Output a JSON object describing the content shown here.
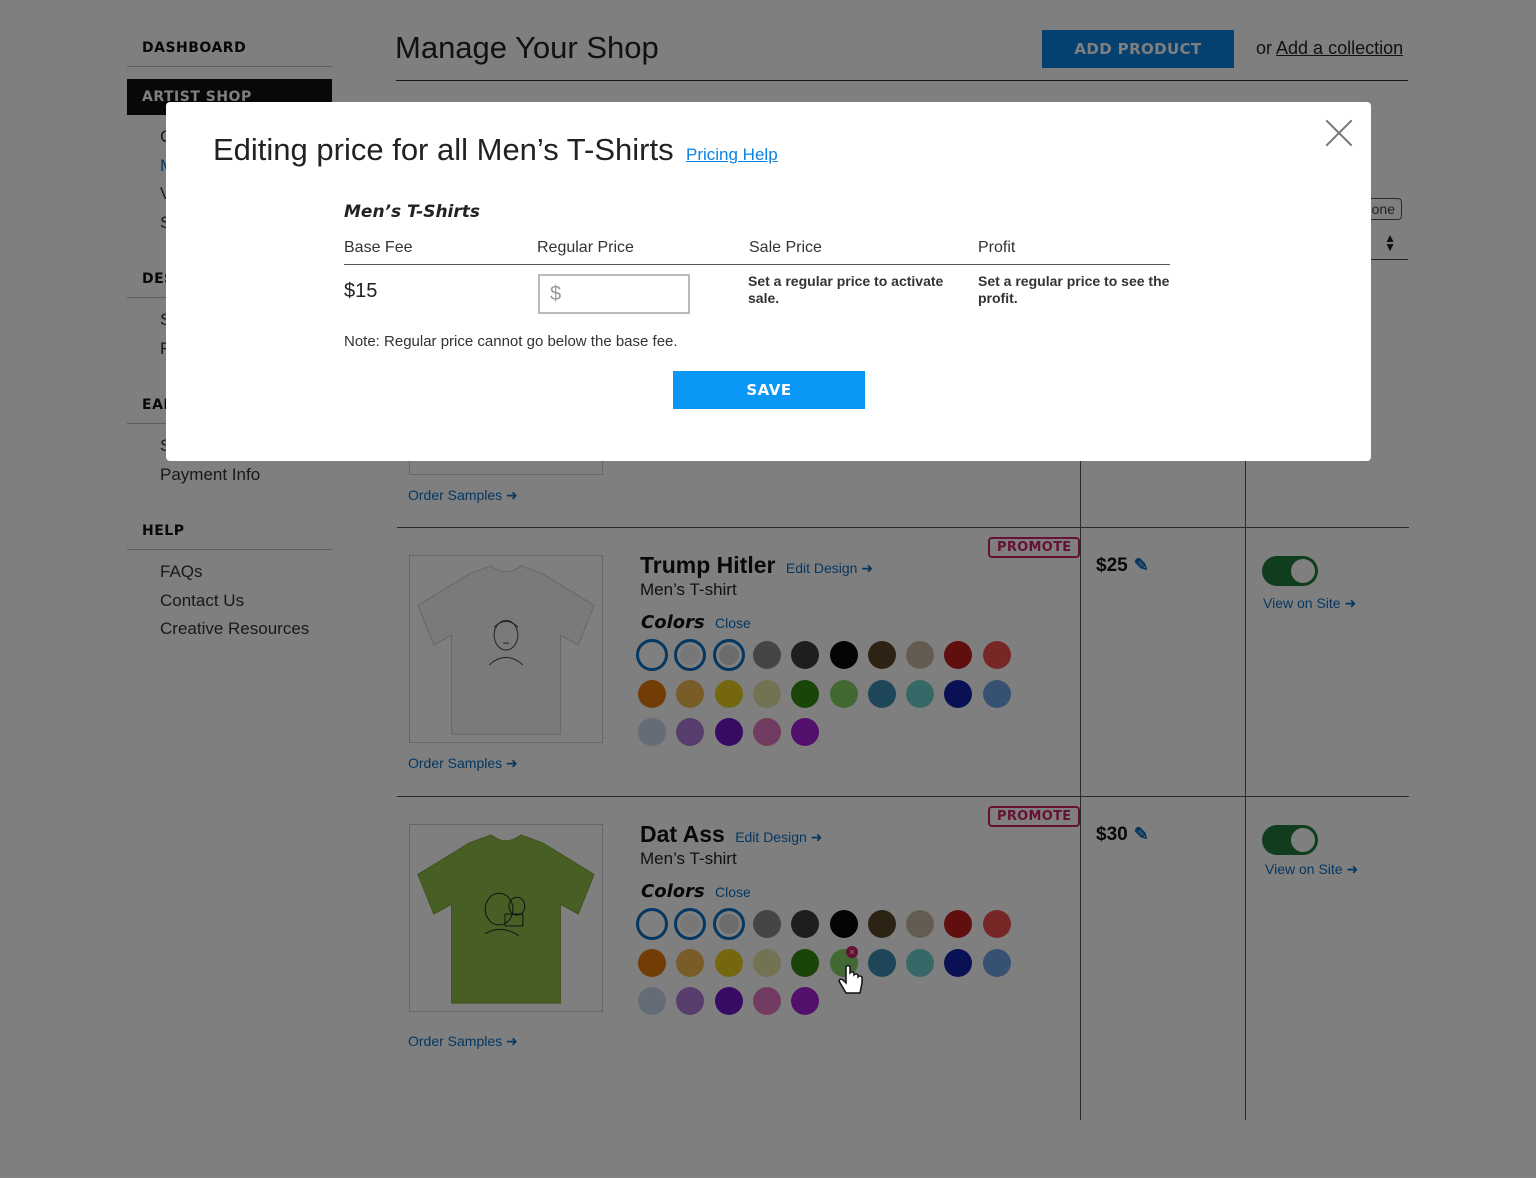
{
  "sidebar": {
    "dashboard": "DASHBOARD",
    "artist_shop": "ARTIST SHOP",
    "artist_shop_items": [
      "C",
      "M",
      "V",
      "S"
    ],
    "design": "DES",
    "design_items": [
      "S",
      "F"
    ],
    "earnings": "EAI",
    "earnings_items": [
      "S",
      "Payment Info"
    ],
    "help": "HELP",
    "help_items": [
      "FAQs",
      "Contact Us",
      "Creative Resources"
    ]
  },
  "header": {
    "title": "Manage Your Shop",
    "add_product": "ADD PRODUCT",
    "or": "or",
    "add_collection": "Add a collection"
  },
  "background": {
    "filter_label": "one",
    "select_arrows": "▲▼"
  },
  "modal": {
    "title": "Editing price for all Men’s T-Shirts",
    "pricing_help": "Pricing Help",
    "section_title": "Men’s T-Shirts",
    "columns": [
      "Base Fee",
      "Regular Price",
      "Sale Price",
      "Profit"
    ],
    "base_fee": "$15",
    "price_placeholder": "$",
    "sale_note": "Set a regular price to activate sale.",
    "profit_note": "Set a regular price to see the profit.",
    "footnote": "Note: Regular price cannot go below the base fee.",
    "save": "SAVE"
  },
  "products": [
    {
      "order_samples": "Order Samples ➜"
    },
    {
      "title": "Trump Hitler",
      "edit_design": "Edit Design ➜",
      "type": "Men’s T-shirt",
      "colors_label": "Colors",
      "colors_close": "Close",
      "promote": "PROMOTE",
      "price": "$25",
      "view_on_site": "View on Site ➜",
      "order_samples": "Order Samples ➜",
      "enabled": true,
      "shirt_color": "#f4f4f4"
    },
    {
      "title": "Dat Ass",
      "edit_design": "Edit Design ➜",
      "type": "Men’s T-shirt",
      "colors_label": "Colors",
      "colors_close": "Close",
      "promote": "PROMOTE",
      "price": "$30",
      "view_on_site": "View on Site ➜",
      "order_samples": "Order Samples ➜",
      "enabled": true,
      "shirt_color": "#8fbf4a"
    }
  ],
  "swatch_colors": [
    "#ffffff",
    "#eeeeee",
    "#d8d8d8",
    "#8a8a8a",
    "#3d3d3d",
    "#080808",
    "#5b4629",
    "#c9b8a0",
    "#c21c1c",
    "#f04f4f",
    "#e2780a",
    "#f2b84e",
    "#e8cf1c",
    "#e6e5a6",
    "#358a11",
    "#86d364",
    "#3a8fb0",
    "#6ad1cc",
    "#1323a8",
    "#6fa3e6",
    "#c9d8ee",
    "#b07ddb",
    "#6f14c6",
    "#e576c4",
    "#a51ed8"
  ],
  "colors": {
    "accent": "#0b82e0",
    "promote": "#cc2266",
    "toggle_on": "#1f7a3a"
  }
}
